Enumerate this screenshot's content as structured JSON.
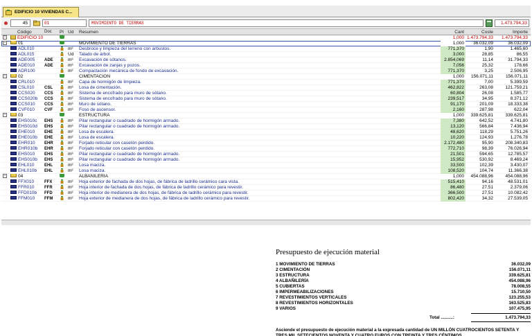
{
  "window": {
    "tab_label": "EDIFICIO 10 VIVIENDAS C...",
    "toolbar": {
      "number": "45",
      "code": "01",
      "description": "MOVIMIENTO DE TIERRAS",
      "total": "1.473.794,33"
    }
  },
  "grid": {
    "columns": [
      "Código",
      "Doc",
      "Pl",
      "Ud",
      "Resumen",
      "Cant",
      "Coste",
      "Importe"
    ],
    "root": {
      "code": "EDIFICIO 10",
      "cant": "1,000",
      "cost": "1.473.794,33",
      "imp": "1.473.794,33"
    },
    "chapters": [
      {
        "code": "01",
        "desc": "MOVIMIENTO DE TIERRAS",
        "cant": "1,000",
        "cost": "36.032,09",
        "imp": "36.032,09",
        "items": [
          {
            "code": "ADL010",
            "doc": "",
            "ud": "m²",
            "desc": "Desbroce y limpieza del terreno con arbustos.",
            "cant": "771,370",
            "cost": "1,90",
            "imp": "1.465,60"
          },
          {
            "code": "ADL015",
            "doc": "",
            "ud": "Ud",
            "desc": "Talado de árbol.",
            "cant": "3,000",
            "cost": "28,85",
            "imp": "86,55"
          },
          {
            "code": "ADE005",
            "doc": "ADE",
            "ud": "m³",
            "desc": "Excavación de sótanos.",
            "cant": "2.854,069",
            "cost": "11,14",
            "imp": "31.794,33"
          },
          {
            "code": "ADE010",
            "doc": "ADE",
            "ud": "m³",
            "desc": "Excavación de zanjas y pozos.",
            "cant": "7,056",
            "cost": "25,32",
            "imp": "178,66"
          },
          {
            "code": "ADR100",
            "doc": "",
            "ud": "m²",
            "desc": "Compactación mecánica de fondo de excavación.",
            "cant": "771,370",
            "cost": "3,25",
            "imp": "2.506,95"
          }
        ]
      },
      {
        "code": "02",
        "desc": "CIMENTACIÓN",
        "cant": "1,000",
        "cost": "156.071,11",
        "imp": "156.071,11",
        "items": [
          {
            "code": "CRL010",
            "doc": "",
            "ud": "m²",
            "desc": "Capa de hormigón de limpieza.",
            "cant": "771,370",
            "cost": "7,00",
            "imp": "5.399,59"
          },
          {
            "code": "CSL010",
            "doc": "CSL",
            "ud": "m³",
            "desc": "Losa de cimentación.",
            "cant": "462,822",
            "cost": "263,08",
            "imp": "121.759,21"
          },
          {
            "code": "CCS020",
            "doc": "CCS",
            "ud": "m²",
            "desc": "Sistema de encofrado para muro de sótano.",
            "cant": "60,804",
            "cost": "26,08",
            "imp": "1.585,77"
          },
          {
            "code": "CCS020b",
            "doc": "CCS",
            "ud": "m²",
            "desc": "Sistema de encofrado para muro de sótano.",
            "cant": "239,517",
            "cost": "34,95",
            "imp": "8.371,12"
          },
          {
            "code": "CCS010",
            "doc": "CCS",
            "ud": "m³",
            "desc": "Muro de sótano.",
            "cant": "91,170",
            "cost": "201,09",
            "imp": "18.333,38"
          },
          {
            "code": "CVF010",
            "doc": "CVF",
            "ud": "m³",
            "desc": "Foso de ascensor.",
            "cant": "2,160",
            "cost": "287,98",
            "imp": "622,04"
          }
        ]
      },
      {
        "code": "03",
        "desc": "ESTRUCTURA",
        "cant": "1,000",
        "cost": "339.625,81",
        "imp": "339.625,81",
        "items": [
          {
            "code": "EHS010c",
            "doc": "EHS",
            "ud": "m³",
            "desc": "Pilar rectangular o cuadrado de hormigón armado.",
            "cant": "7,380",
            "cost": "642,52",
            "imp": "4.741,80"
          },
          {
            "code": "EHS010d",
            "doc": "EHS",
            "ud": "m³",
            "desc": "Pilar rectangular o cuadrado de hormigón armado.",
            "cant": "13,120",
            "cost": "566,84",
            "imp": "7.436,94"
          },
          {
            "code": "EHE010",
            "doc": "EHE",
            "ud": "m²",
            "desc": "Losa de escalera.",
            "cant": "48,620",
            "cost": "118,29",
            "imp": "5.751,26"
          },
          {
            "code": "EHE010b",
            "doc": "EHE",
            "ud": "m²",
            "desc": "Losa de escalera.",
            "cant": "10,220",
            "cost": "124,93",
            "imp": "1.276,78"
          },
          {
            "code": "EHR010",
            "doc": "EHR",
            "ud": "m²",
            "desc": "Forjado reticular con casetón perdido.",
            "cant": "2.172,480",
            "cost": "95,90",
            "imp": "208.340,83"
          },
          {
            "code": "EHR010b",
            "doc": "EHR",
            "ud": "m²",
            "desc": "Forjado reticular con casetón perdido.",
            "cant": "772,710",
            "cost": "98,39",
            "imp": "76.026,94"
          },
          {
            "code": "EHS010",
            "doc": "EHS",
            "ud": "m³",
            "desc": "Pilar rectangular o cuadrado de hormigón armado.",
            "cant": "21,501",
            "cost": "594,65",
            "imp": "12.785,57"
          },
          {
            "code": "EHS010b",
            "doc": "EHS",
            "ud": "m³",
            "desc": "Pilar rectangular o cuadrado de hormigón armado.",
            "cant": "15,952",
            "cost": "530,92",
            "imp": "8.469,24"
          },
          {
            "code": "EHL010",
            "doc": "EHL",
            "ud": "m²",
            "desc": "Losa maciza.",
            "cant": "33,500",
            "cost": "102,39",
            "imp": "3.430,07"
          },
          {
            "code": "EHL010b",
            "doc": "EHL",
            "ud": "m²",
            "desc": "Losa maciza.",
            "cant": "108,520",
            "cost": "104,74",
            "imp": "11.366,38"
          }
        ]
      },
      {
        "code": "04",
        "desc": "ALBAÑILERÍA",
        "cant": "1,000",
        "cost": "454.088,96",
        "imp": "454.088,96",
        "items": [
          {
            "code": "FFX010",
            "doc": "FFX",
            "ud": "m²",
            "desc": "Hoja exterior de fachada de dos hojas, de fábrica de ladrillo cerámico cara vista.",
            "cant": "515,410",
            "cost": "94,16",
            "imp": "48.531,01"
          },
          {
            "code": "FFR010",
            "doc": "FFR",
            "ud": "m²",
            "desc": "Hoja interior de fachada de dos hojas, de fábrica de ladrillo cerámico para revestir.",
            "cant": "86,480",
            "cost": "27,51",
            "imp": "2.379,06"
          },
          {
            "code": "FFD010b",
            "doc": "FFD",
            "ud": "m²",
            "desc": "Hoja interior de medianera de dos hojas, de fábrica de ladrillo cerámico para revestir.",
            "cant": "366,500",
            "cost": "27,51",
            "imp": "10.082,42"
          },
          {
            "code": "FFM010",
            "doc": "FFM",
            "ud": "m²",
            "desc": "Hoja exterior de medianera de dos hojas, de fábrica de ladrillo cerámico para revestir.",
            "cant": "802,420",
            "cost": "34,32",
            "imp": "27.539,05"
          }
        ]
      }
    ]
  },
  "summary": {
    "title": "Presupuesto de ejecución material",
    "chapters": [
      {
        "name": "1 MOVIMIENTO DE TIERRAS",
        "amount": "36.032,09"
      },
      {
        "name": "2 CIMENTACIÓN",
        "amount": "156.071,11"
      },
      {
        "name": "3 ESTRUCTURA",
        "amount": "339.625,81"
      },
      {
        "name": "4 ALBAÑILERÍA",
        "amount": "454.088,96"
      },
      {
        "name": "5 CUBIERTAS",
        "amount": "78.008,55"
      },
      {
        "name": "6 IMPERMEABILIZACIONES",
        "amount": "15.710,50"
      },
      {
        "name": "7 REVESTIMIENTOS VERTICALES",
        "amount": "123.255,53"
      },
      {
        "name": "8 REVESTIMIENTOS HORIZONTALES",
        "amount": "163.525,83"
      },
      {
        "name": "9 VARIOS",
        "amount": "107.475,95"
      }
    ],
    "total_label": "Total ..........:",
    "total_amount": "1.473.794,33",
    "note": "Asciende el presupuesto de ejecución material a la expresada cantidad de UN MILLÓN CUATROCIENTOS SETENTA Y TRES MIL SETECIENTOS NOVENTA Y CUATRO EUROS CON TREINTA Y TRES CÉNTIMOS."
  }
}
